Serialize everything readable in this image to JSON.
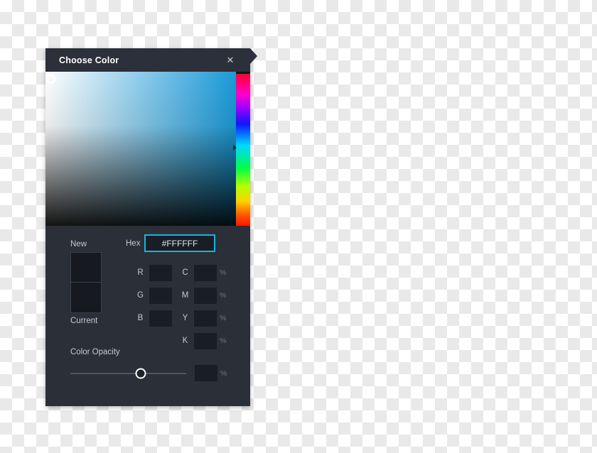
{
  "dialog": {
    "title": "Choose Color",
    "close_icon": "close-icon",
    "tab_icon": "arrow-tab-icon"
  },
  "picker": {
    "sv_field_name": "saturation-value-field",
    "sv_cursor_name": "sv-cursor",
    "hue_strip_name": "hue-strip",
    "selected_hue_hex": "#1a9ad8"
  },
  "swatches": {
    "new_label": "New",
    "current_label": "Current",
    "new_color": "#16191F",
    "current_color": "#16191F"
  },
  "hex": {
    "label": "Hex",
    "value": "#FFFFFF",
    "placeholder": "#FFFFFF",
    "border_color": "#17B4E0"
  },
  "rgb": [
    {
      "label": "R",
      "value": "",
      "placeholder": ""
    },
    {
      "label": "G",
      "value": "",
      "placeholder": ""
    },
    {
      "label": "B",
      "value": "",
      "placeholder": ""
    }
  ],
  "cmyk": [
    {
      "label": "C",
      "value": "",
      "placeholder": "",
      "unit": "%"
    },
    {
      "label": "M",
      "value": "",
      "placeholder": "",
      "unit": "%"
    },
    {
      "label": "Y",
      "value": "",
      "placeholder": "",
      "unit": "%"
    },
    {
      "label": "K",
      "value": "",
      "placeholder": "",
      "unit": "%"
    }
  ],
  "opacity": {
    "label": "Color Opacity",
    "value": "",
    "placeholder": "",
    "unit": "%"
  }
}
